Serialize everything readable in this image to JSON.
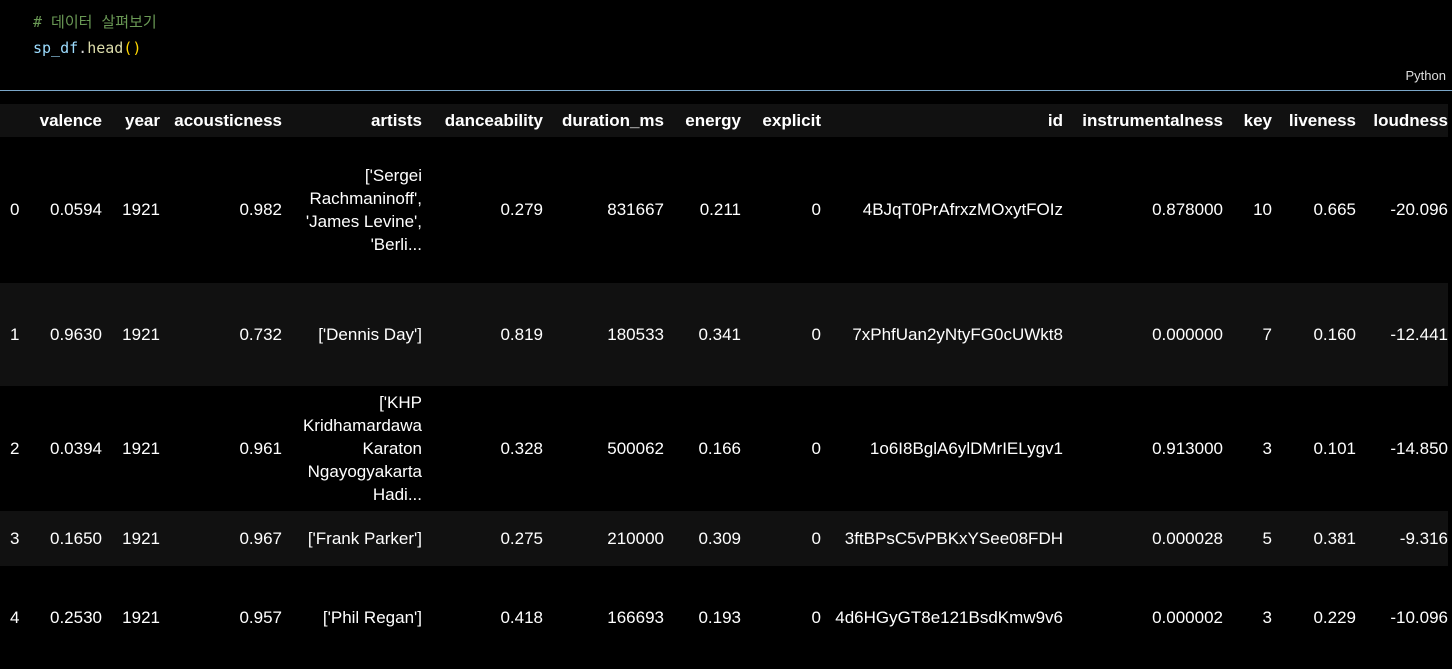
{
  "code": {
    "comment": "# 데이터 살펴보기",
    "ident": "sp_df",
    "dot": ".",
    "func": "head",
    "parens": "()"
  },
  "language": "Python",
  "table": {
    "columns": [
      "",
      "valence",
      "year",
      "acousticness",
      "artists",
      "danceability",
      "duration_ms",
      "energy",
      "explicit",
      "id",
      "instrumentalness",
      "key",
      "liveness",
      "loudness"
    ],
    "rows": [
      [
        "0",
        "0.0594",
        "1921",
        "0.982",
        "['Sergei Rachmaninoff', 'James Levine', 'Berli...",
        "0.279",
        "831667",
        "0.211",
        "0",
        "4BJqT0PrAfrxzMOxytFOIz",
        "0.878000",
        "10",
        "0.665",
        "-20.096"
      ],
      [
        "1",
        "0.9630",
        "1921",
        "0.732",
        "['Dennis Day']",
        "0.819",
        "180533",
        "0.341",
        "0",
        "7xPhfUan2yNtyFG0cUWkt8",
        "0.000000",
        "7",
        "0.160",
        "-12.441"
      ],
      [
        "2",
        "0.0394",
        "1921",
        "0.961",
        "['KHP Kridhamardawa Karaton Ngayogyakarta Hadi...",
        "0.328",
        "500062",
        "0.166",
        "0",
        "1o6I8BglA6ylDMrIELygv1",
        "0.913000",
        "3",
        "0.101",
        "-14.850"
      ],
      [
        "3",
        "0.1650",
        "1921",
        "0.967",
        "['Frank Parker']",
        "0.275",
        "210000",
        "0.309",
        "0",
        "3ftBPsC5vPBKxYSee08FDH",
        "0.000028",
        "5",
        "0.381",
        "-9.316"
      ],
      [
        "4",
        "0.2530",
        "1921",
        "0.957",
        "['Phil Regan']",
        "0.418",
        "166693",
        "0.193",
        "0",
        "4d6HGyGT8e121BsdKmw9v6",
        "0.000002",
        "3",
        "0.229",
        "-10.096"
      ]
    ]
  }
}
